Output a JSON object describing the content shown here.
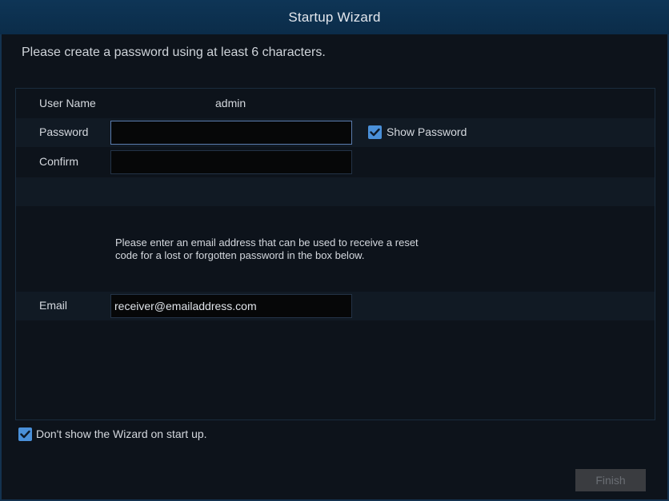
{
  "window": {
    "title": "Startup Wizard"
  },
  "instruction": "Please create a password using at least 6 characters.",
  "form": {
    "username_label": "User Name",
    "username_value": "admin",
    "password_label": "Password",
    "password_value": "",
    "confirm_label": "Confirm",
    "confirm_value": "",
    "show_password": {
      "label": "Show Password",
      "checked": true,
      "icon": "checkmark-icon"
    },
    "email_message_line1": "Please enter an email address that can be used to receive a reset",
    "email_message_line2": "code for a lost or forgotten password in the box below.",
    "email_label": "Email",
    "email_value": "receiver@emailaddress.com"
  },
  "footer": {
    "dont_show_wizard": {
      "label": "Don't show the Wizard on start up.",
      "checked": true,
      "icon": "checkmark-icon"
    },
    "finish_label": "Finish"
  },
  "colors": {
    "titlebar": "#0b2c49",
    "background": "#0d131b",
    "checkbox_accent": "#4a90d9",
    "focus_border": "#5a7cae",
    "button_disabled": "#3a3c40"
  }
}
